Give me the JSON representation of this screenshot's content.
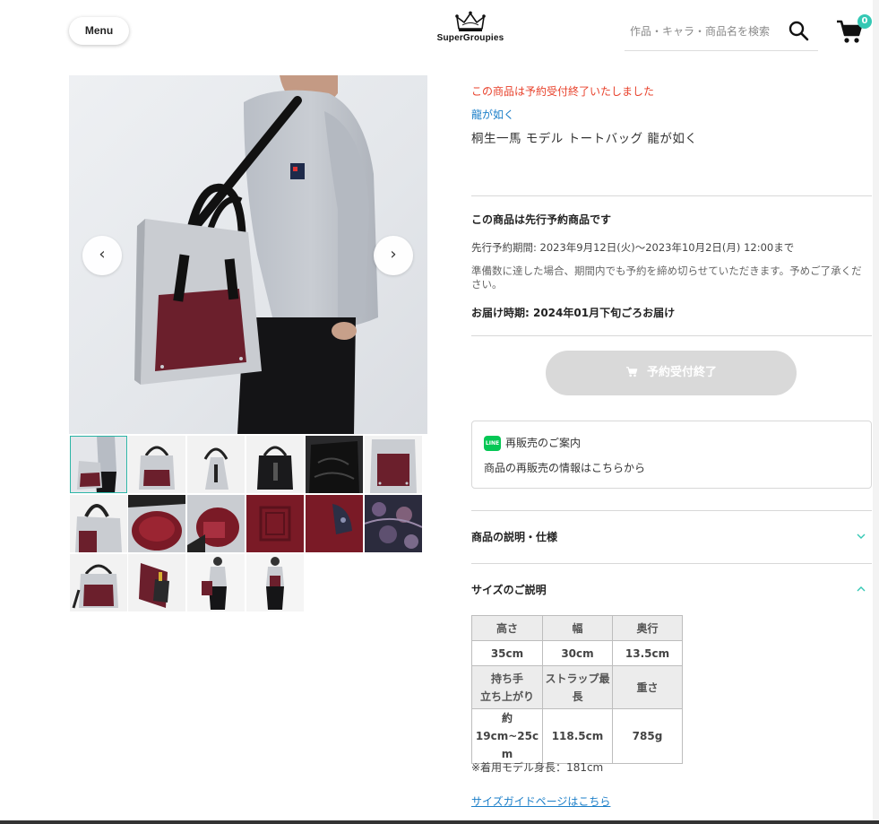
{
  "header": {
    "menu_label": "Menu",
    "logo_text": "SuperGroupies",
    "search_placeholder": "作品・キャラ・商品名を検索",
    "cart_count": "0"
  },
  "gallery": {
    "prev_label": "‹",
    "next_label": "›",
    "thumbnail_count": 16,
    "active_index": 0
  },
  "product": {
    "status_notice": "この商品は予約受付終了いたしました",
    "series": "龍が如く",
    "title": "桐生一馬 モデル トートバッグ 龍が如く"
  },
  "preorder": {
    "heading": "この商品は先行予約商品です",
    "period": "先行予約期間: 2023年9月12日(火)〜2023年10月2日(月) 12:00まで",
    "note": "準備数に達した場合、期間内でも予約を締め切らせていただきます。予めご了承ください。",
    "delivery": "お届け時期: 2024年01月下旬ごろお届け"
  },
  "order_button": {
    "label": "予約受付終了",
    "state": "disabled"
  },
  "resale": {
    "icon_label": "LINE",
    "title": "再販売のご案内",
    "text": "商品の再販売の情報はこちらから"
  },
  "accordions": {
    "description_label": "商品の説明・仕様",
    "description_state": "collapsed",
    "size_label": "サイズのご説明",
    "size_state": "expanded"
  },
  "size_table": {
    "row1": [
      "高さ",
      "幅",
      "奥行"
    ],
    "row2": [
      "35cm",
      "30cm",
      "13.5cm"
    ],
    "row3": [
      "持ち手\n立ち上がり",
      "ストラップ最\n長",
      "重さ"
    ],
    "row4": [
      "約19cm~25c\nm",
      "118.5cm",
      "785g"
    ]
  },
  "model_note": "※着用モデル身長：181cm",
  "size_guide_link": "サイズガイドページはこちら",
  "colors": {
    "accent_teal": "#34c8b4",
    "notice_red": "#e8412b",
    "link_blue": "#1a7ec8",
    "line_green": "#06c755",
    "bag_burgundy": "#6b1f2c",
    "bag_grey": "#c9ccd1"
  }
}
